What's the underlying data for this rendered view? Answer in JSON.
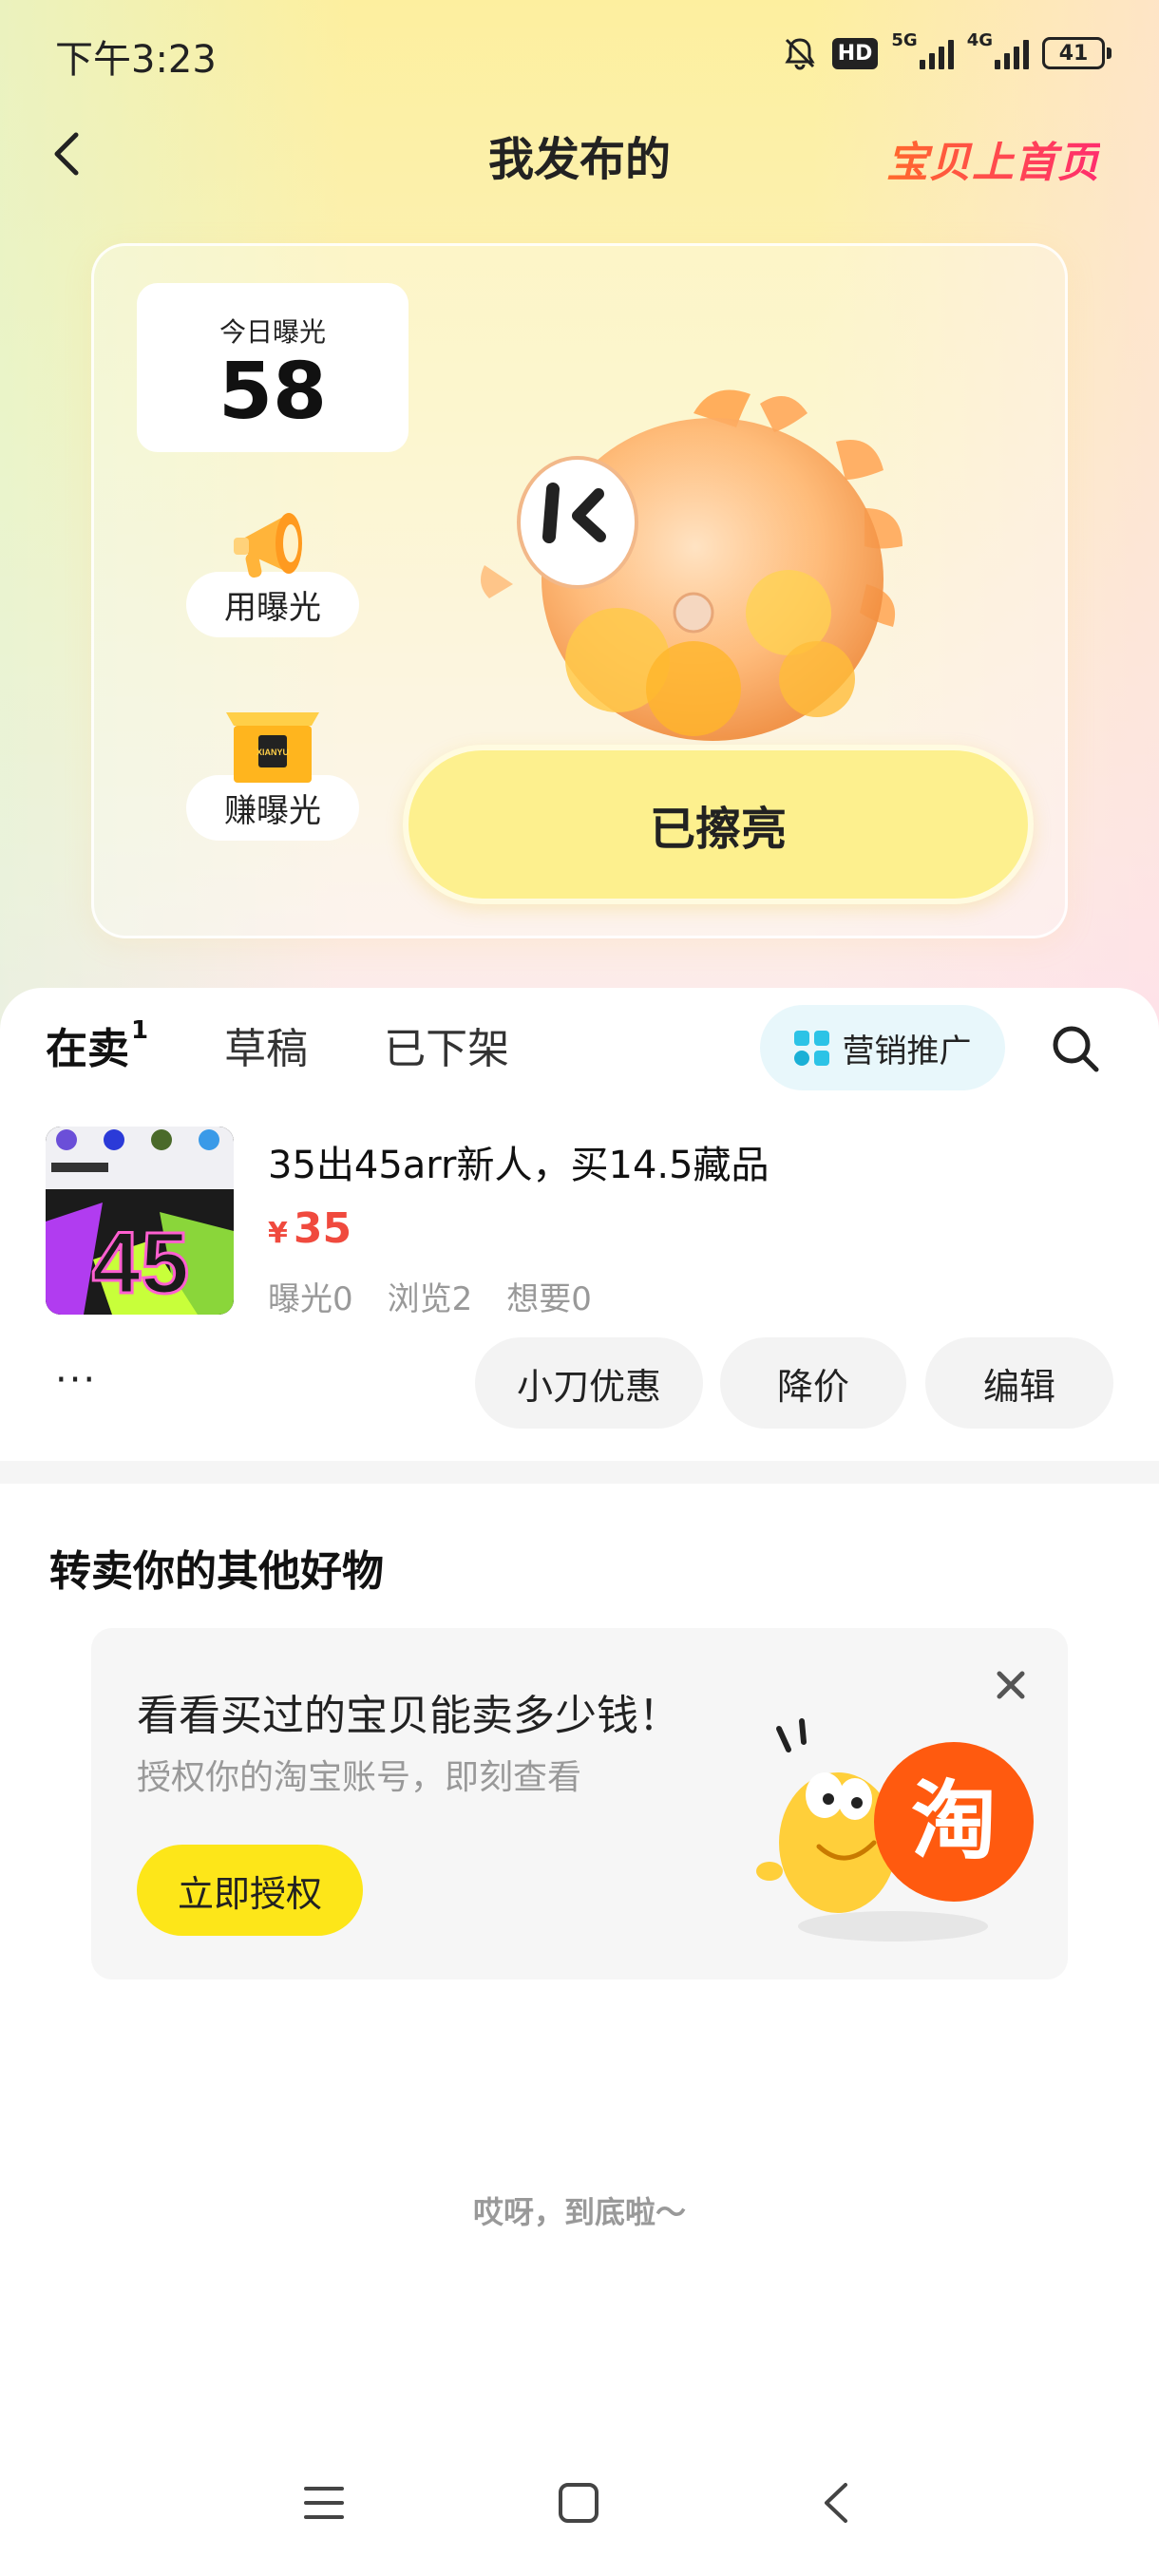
{
  "status_bar": {
    "time": "下午3:23",
    "hd_label": "HD",
    "network_5g": "5G",
    "network_4g": "4G",
    "battery": "41"
  },
  "header": {
    "title": "我发布的",
    "promo_link": "宝贝上首页"
  },
  "exposure_card": {
    "today_label": "今日曝光",
    "today_value": "58",
    "use_exposure": "用曝光",
    "earn_exposure": "赚曝光",
    "box_label": "XIANYU",
    "lit_button": "已擦亮"
  },
  "tabs": [
    {
      "label": "在卖",
      "badge": "1"
    },
    {
      "label": "草稿"
    },
    {
      "label": "已下架"
    }
  ],
  "marketing_label": "营销推广",
  "item": {
    "title": "35出45arr新人，买14.5藏品",
    "currency": "¥",
    "price": "35",
    "stats": [
      "曝光0",
      "浏览2",
      "想要0"
    ],
    "actions": {
      "knife": "小刀优惠",
      "reduce": "降价",
      "edit": "编辑"
    },
    "more": "···",
    "thumb_text": "45"
  },
  "resell": {
    "title": "转卖你的其他好物",
    "heading": "看看买过的宝贝能卖多少钱！",
    "subtitle": "授权你的淘宝账号，即刻查看",
    "button": "立即授权",
    "taobao_glyph": "淘"
  },
  "end_text": "哎呀，到底啦～",
  "colors": {
    "accent_yellow": "#fde619",
    "price_red": "#f04a3e",
    "promo_gradient_start": "#ff6a2b",
    "promo_gradient_end": "#ff2d6e"
  },
  "icons": [
    "back-icon",
    "search-icon",
    "close-icon",
    "megaphone-icon",
    "box-icon",
    "grid-icon",
    "menu-icon",
    "home-icon",
    "nav-back-icon",
    "mute-bell-icon"
  ]
}
